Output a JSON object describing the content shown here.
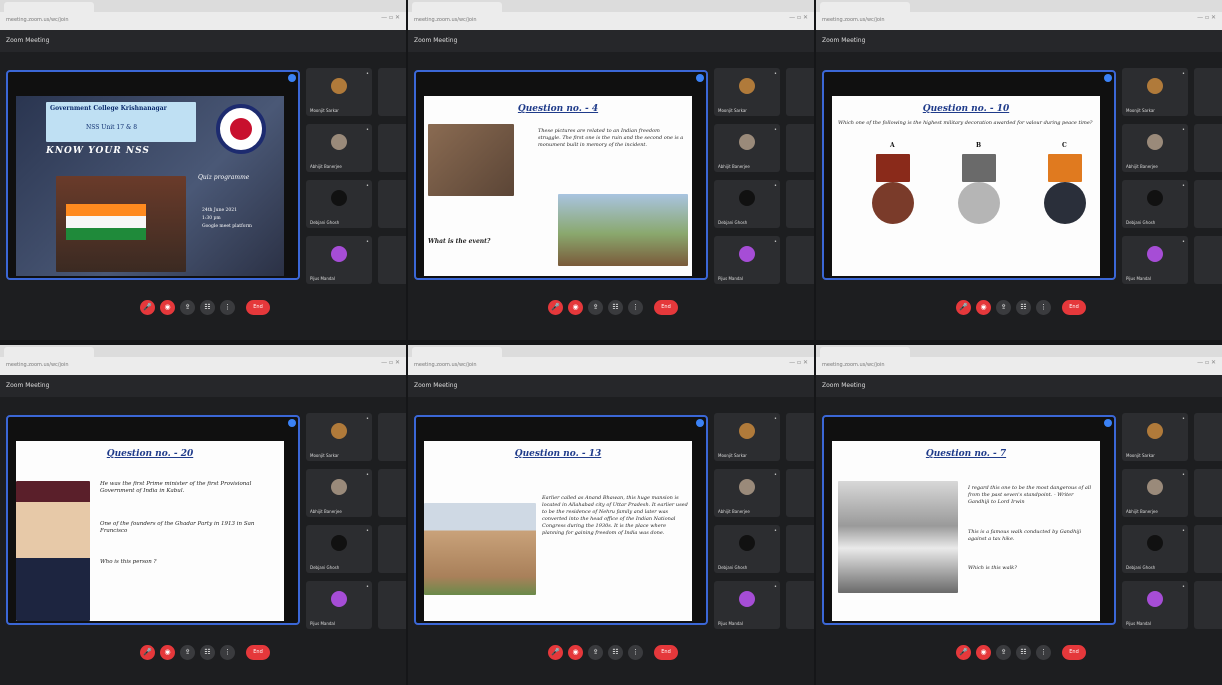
{
  "browser": {
    "url_text": "meeting.zoom.us/wc/join",
    "window_controls": "— ▫ ✕"
  },
  "meeting": {
    "header_title": "Zoom Meeting"
  },
  "participants": [
    {
      "name": "Moonjit Sarkar",
      "avatar_color": "#b07a3a"
    },
    {
      "name": "Abhijit Banerjee",
      "avatar_color": "#9a8a7a"
    },
    {
      "name": "Debjani Ghosh",
      "avatar_color": "#111111"
    },
    {
      "name": "Pijus Mandal",
      "avatar_color": "#a64dd6"
    }
  ],
  "controls": {
    "mute_icon": "mic-off-icon",
    "video_icon": "video-off-icon",
    "share_icon": "share-icon",
    "participants_icon": "participants-icon",
    "more_icon": "more-icon",
    "end_label": "End"
  },
  "slides": [
    {
      "kind": "title",
      "college": "Government College Krishnanagar",
      "unit": "NSS Unit 17 & 8",
      "headline": "KNOW YOUR NSS",
      "subtitle": "Quiz programme",
      "date": "24th June 2021",
      "time": "1:30 pm",
      "platform": "Google meet platform"
    },
    {
      "kind": "q",
      "title": "Question no. - 4",
      "text": "These pictures are related to an Indian freedom struggle. The first one is the ruin and the second one is a monument built in memory of the incident.",
      "bottom": "What is the event?"
    },
    {
      "kind": "medals",
      "title": "Question no. - 10",
      "text": "Which one of the following is the highest military decoration awarded for valour during peace time?",
      "labels": [
        "A",
        "B",
        "C"
      ]
    },
    {
      "kind": "q",
      "title": "Question no. - 20",
      "bullets": [
        "He was the first Prime minister of the first Provisional Government of India in Kabul.",
        "One of the founders of the Ghadar Party in 1913 in San Francisco"
      ],
      "bottom": "Who is this person ?"
    },
    {
      "kind": "q",
      "title": "Question no. - 13",
      "text": "Earlier called as Anand Bhawan, this huge mansion is located in Allahabad city of Uttar Pradesh. It earlier used to be the residence of Nehru family and later was converted into the head office of the Indian National Congress during the 1930s. It is the place where planning for gaining freedom of India was done."
    },
    {
      "kind": "q",
      "title": "Question no. - 7",
      "text": "I regard this one to be the most dangerous of all from the past seven's standpoint. - Writer Gandhiji to Lord Irwin",
      "text2": "This is a famous walk conducted by Gandhiji against a tax hike.",
      "bottom": "Which is this walk?"
    }
  ]
}
